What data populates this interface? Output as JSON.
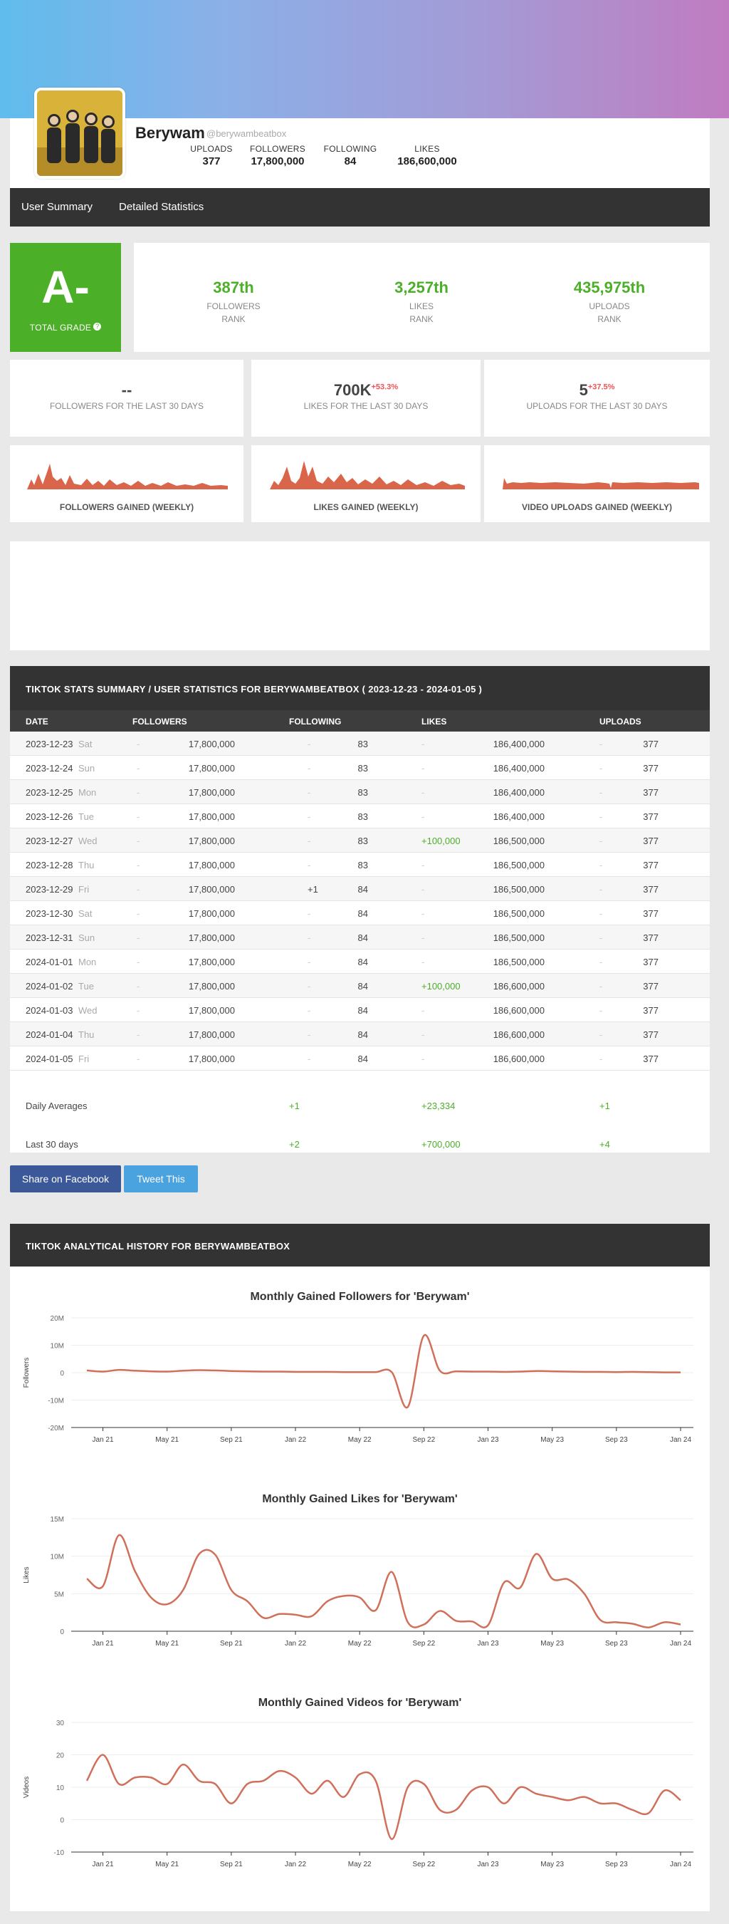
{
  "profile": {
    "name": "Berywam",
    "handle": "@berywambeatbox",
    "stats": [
      {
        "label": "UPLOADS",
        "value": "377"
      },
      {
        "label": "FOLLOWERS",
        "value": "17,800,000"
      },
      {
        "label": "FOLLOWING",
        "value": "84"
      },
      {
        "label": "LIKES",
        "value": "186,600,000"
      }
    ]
  },
  "nav": {
    "user_summary": "User Summary",
    "detailed_statistics": "Detailed Statistics"
  },
  "grade": {
    "letter": "A-",
    "label": "TOTAL GRADE",
    "help": "?"
  },
  "ranks": [
    {
      "value": "387th",
      "label1": "FOLLOWERS",
      "label2": "RANK"
    },
    {
      "value": "3,257th",
      "label1": "LIKES",
      "label2": "RANK"
    },
    {
      "value": "435,975th",
      "label1": "UPLOADS",
      "label2": "RANK"
    }
  ],
  "last30": [
    {
      "value": "--",
      "change": "",
      "label": "FOLLOWERS FOR THE LAST 30 DAYS"
    },
    {
      "value": "700K",
      "change": "+53.3%",
      "label": "LIKES FOR THE LAST 30 DAYS"
    },
    {
      "value": "5",
      "change": "+37.5%",
      "label": "UPLOADS FOR THE LAST 30 DAYS"
    }
  ],
  "sparks": [
    {
      "title": "FOLLOWERS GAINED (WEEKLY)",
      "color": "#d9654a"
    },
    {
      "title": "LIKES GAINED (WEEKLY)",
      "color": "#d9654a"
    },
    {
      "title": "VIDEO UPLOADS GAINED (WEEKLY)",
      "color": "#d9654a"
    }
  ],
  "table": {
    "title": "TIKTOK STATS SUMMARY / USER STATISTICS FOR BERYWAMBEATBOX ( 2023-12-23 - 2024-01-05 )",
    "columns": [
      "DATE",
      "FOLLOWERS",
      "FOLLOWING",
      "LIKES",
      "UPLOADS"
    ],
    "rows": [
      {
        "date": "2023-12-23",
        "day": "Sat",
        "fch": "-",
        "followers": "17,800,000",
        "gch": "-",
        "following": "83",
        "lch": "-",
        "likes": "186,400,000",
        "uch": "-",
        "uploads": "377"
      },
      {
        "date": "2023-12-24",
        "day": "Sun",
        "fch": "-",
        "followers": "17,800,000",
        "gch": "-",
        "following": "83",
        "lch": "-",
        "likes": "186,400,000",
        "uch": "-",
        "uploads": "377"
      },
      {
        "date": "2023-12-25",
        "day": "Mon",
        "fch": "-",
        "followers": "17,800,000",
        "gch": "-",
        "following": "83",
        "lch": "-",
        "likes": "186,400,000",
        "uch": "-",
        "uploads": "377"
      },
      {
        "date": "2023-12-26",
        "day": "Tue",
        "fch": "-",
        "followers": "17,800,000",
        "gch": "-",
        "following": "83",
        "lch": "-",
        "likes": "186,400,000",
        "uch": "-",
        "uploads": "377"
      },
      {
        "date": "2023-12-27",
        "day": "Wed",
        "fch": "-",
        "followers": "17,800,000",
        "gch": "-",
        "following": "83",
        "lch": "+100,000",
        "likes": "186,500,000",
        "uch": "-",
        "uploads": "377"
      },
      {
        "date": "2023-12-28",
        "day": "Thu",
        "fch": "-",
        "followers": "17,800,000",
        "gch": "-",
        "following": "83",
        "lch": "-",
        "likes": "186,500,000",
        "uch": "-",
        "uploads": "377"
      },
      {
        "date": "2023-12-29",
        "day": "Fri",
        "fch": "-",
        "followers": "17,800,000",
        "gch": "+1",
        "following": "84",
        "lch": "-",
        "likes": "186,500,000",
        "uch": "-",
        "uploads": "377"
      },
      {
        "date": "2023-12-30",
        "day": "Sat",
        "fch": "-",
        "followers": "17,800,000",
        "gch": "-",
        "following": "84",
        "lch": "-",
        "likes": "186,500,000",
        "uch": "-",
        "uploads": "377"
      },
      {
        "date": "2023-12-31",
        "day": "Sun",
        "fch": "-",
        "followers": "17,800,000",
        "gch": "-",
        "following": "84",
        "lch": "-",
        "likes": "186,500,000",
        "uch": "-",
        "uploads": "377"
      },
      {
        "date": "2024-01-01",
        "day": "Mon",
        "fch": "-",
        "followers": "17,800,000",
        "gch": "-",
        "following": "84",
        "lch": "-",
        "likes": "186,500,000",
        "uch": "-",
        "uploads": "377"
      },
      {
        "date": "2024-01-02",
        "day": "Tue",
        "fch": "-",
        "followers": "17,800,000",
        "gch": "-",
        "following": "84",
        "lch": "+100,000",
        "likes": "186,600,000",
        "uch": "-",
        "uploads": "377"
      },
      {
        "date": "2024-01-03",
        "day": "Wed",
        "fch": "-",
        "followers": "17,800,000",
        "gch": "-",
        "following": "84",
        "lch": "-",
        "likes": "186,600,000",
        "uch": "-",
        "uploads": "377"
      },
      {
        "date": "2024-01-04",
        "day": "Thu",
        "fch": "-",
        "followers": "17,800,000",
        "gch": "-",
        "following": "84",
        "lch": "-",
        "likes": "186,600,000",
        "uch": "-",
        "uploads": "377"
      },
      {
        "date": "2024-01-05",
        "day": "Fri",
        "fch": "-",
        "followers": "17,800,000",
        "gch": "-",
        "following": "84",
        "lch": "-",
        "likes": "186,600,000",
        "uch": "-",
        "uploads": "377"
      }
    ],
    "daily_averages": {
      "label": "Daily Averages",
      "following": "+1",
      "likes": "+23,334",
      "uploads": "+1"
    },
    "last_30_days": {
      "label": "Last 30 days",
      "following": "+2",
      "likes": "+700,000",
      "uploads": "+4"
    }
  },
  "share": {
    "facebook": "Share on Facebook",
    "tweet": "Tweet This"
  },
  "history": {
    "title": "TIKTOK ANALYTICAL HISTORY FOR BERYWAMBEATBOX",
    "x_ticks": [
      "Jan 21",
      "May 21",
      "Sep 21",
      "Jan 22",
      "May 22",
      "Sep 22",
      "Jan 23",
      "May 23",
      "Sep 23",
      "Jan 24"
    ]
  },
  "chart_data": [
    {
      "type": "line",
      "title": "Monthly Gained Followers for 'Berywam'",
      "ylabel": "Followers",
      "ylim": [
        -20000000,
        20000000
      ],
      "yticks": [
        "20M",
        "10M",
        "0",
        "-10M",
        "-20M"
      ],
      "x": [
        "2020-12",
        "2021-01",
        "2021-02",
        "2021-03",
        "2021-04",
        "2021-05",
        "2021-06",
        "2021-07",
        "2021-08",
        "2021-09",
        "2021-10",
        "2021-11",
        "2021-12",
        "2022-01",
        "2022-02",
        "2022-03",
        "2022-04",
        "2022-05",
        "2022-06",
        "2022-07",
        "2022-08",
        "2022-09",
        "2022-10",
        "2022-11",
        "2022-12",
        "2023-01",
        "2023-02",
        "2023-03",
        "2023-04",
        "2023-05",
        "2023-06",
        "2023-07",
        "2023-08",
        "2023-09",
        "2023-10",
        "2023-11",
        "2023-12",
        "2024-01"
      ],
      "series": [
        {
          "values": [
            800000,
            400000,
            1000000,
            700000,
            500000,
            400000,
            700000,
            900000,
            800000,
            600000,
            500000,
            400000,
            400000,
            300000,
            300000,
            300000,
            200000,
            200000,
            200000,
            200000,
            -12500000,
            13500000,
            700000,
            500000,
            400000,
            400000,
            300000,
            400000,
            600000,
            500000,
            400000,
            300000,
            300000,
            200000,
            300000,
            200000,
            100000,
            100000
          ],
          "color": "#d0705a"
        }
      ]
    },
    {
      "type": "line",
      "title": "Monthly Gained Likes for 'Berywam'",
      "ylabel": "Likes",
      "ylim": [
        0,
        15000000
      ],
      "yticks": [
        "15M",
        "10M",
        "5M",
        "0"
      ],
      "x": [
        "2020-12",
        "2021-01",
        "2021-02",
        "2021-03",
        "2021-04",
        "2021-05",
        "2021-06",
        "2021-07",
        "2021-08",
        "2021-09",
        "2021-10",
        "2021-11",
        "2021-12",
        "2022-01",
        "2022-02",
        "2022-03",
        "2022-04",
        "2022-05",
        "2022-06",
        "2022-07",
        "2022-08",
        "2022-09",
        "2022-10",
        "2022-11",
        "2022-12",
        "2023-01",
        "2023-02",
        "2023-03",
        "2023-04",
        "2023-05",
        "2023-06",
        "2023-07",
        "2023-08",
        "2023-09",
        "2023-10",
        "2023-11",
        "2023-12",
        "2024-01"
      ],
      "series": [
        {
          "values": [
            7000000,
            6000000,
            12800000,
            8000000,
            4500000,
            3600000,
            5500000,
            10300000,
            10200000,
            5500000,
            4000000,
            1800000,
            2300000,
            2200000,
            2000000,
            4000000,
            4700000,
            4500000,
            2800000,
            7900000,
            1200000,
            900000,
            2700000,
            1400000,
            1300000,
            800000,
            6500000,
            5800000,
            10300000,
            7000000,
            6900000,
            5000000,
            1500000,
            1200000,
            1000000,
            500000,
            1200000,
            900000
          ],
          "color": "#d0705a"
        }
      ]
    },
    {
      "type": "line",
      "title": "Monthly Gained Videos for 'Berywam'",
      "ylabel": "Videos",
      "ylim": [
        -10,
        30
      ],
      "yticks": [
        "30",
        "20",
        "10",
        "0",
        "-10"
      ],
      "x": [
        "2020-12",
        "2021-01",
        "2021-02",
        "2021-03",
        "2021-04",
        "2021-05",
        "2021-06",
        "2021-07",
        "2021-08",
        "2021-09",
        "2021-10",
        "2021-11",
        "2021-12",
        "2022-01",
        "2022-02",
        "2022-03",
        "2022-04",
        "2022-05",
        "2022-06",
        "2022-07",
        "2022-08",
        "2022-09",
        "2022-10",
        "2022-11",
        "2022-12",
        "2023-01",
        "2023-02",
        "2023-03",
        "2023-04",
        "2023-05",
        "2023-06",
        "2023-07",
        "2023-08",
        "2023-09",
        "2023-10",
        "2023-11",
        "2023-12",
        "2024-01"
      ],
      "series": [
        {
          "values": [
            12,
            20,
            11,
            13,
            13,
            11,
            17,
            12,
            11,
            5,
            11,
            12,
            15,
            13,
            8,
            12,
            7,
            14,
            12,
            -6,
            10,
            11,
            3,
            3,
            9,
            10,
            5,
            10,
            8,
            7,
            6,
            7,
            5,
            5,
            3,
            2,
            9,
            6
          ],
          "color": "#d0705a"
        }
      ]
    }
  ]
}
